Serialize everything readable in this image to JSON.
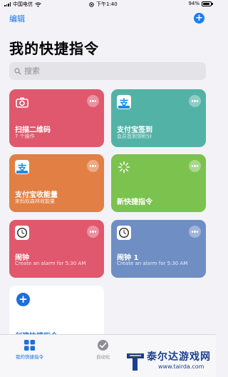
{
  "status_bar": {
    "carrier": "中国电信",
    "time": "下午1:40",
    "battery": "94%"
  },
  "header": {
    "edit_label": "编辑",
    "add_label": "+"
  },
  "page_title": "我的快捷指令",
  "search": {
    "placeholder": "搜索"
  },
  "shortcuts": [
    {
      "name": "扫描二维码",
      "subtitle": "7 个操作",
      "color": "#e0586d",
      "icon": "camera-icon"
    },
    {
      "name": "支付宝签到",
      "subtitle": "会员签到领积分",
      "color": "#53b2a6",
      "icon": "alipay-icon",
      "icon_glyph": "支"
    },
    {
      "name": "支付宝收能量",
      "subtitle": "来蚂蚁森林收能量",
      "color": "#e17f44",
      "icon": "alipay-icon",
      "icon_glyph": "支"
    },
    {
      "name": "新快捷指令",
      "subtitle": "",
      "color": "#7bc24f",
      "icon": "loading-spinner-icon"
    },
    {
      "name": "闹钟",
      "subtitle": "Create an alarm for 5:30 AM",
      "color": "#e0586d",
      "icon": "alarm-clock-icon"
    },
    {
      "name": "闹钟 1",
      "subtitle": "Create an alarm for 5:30 AM",
      "color": "#6f8ec4",
      "icon": "alarm-clock-icon"
    }
  ],
  "create_tile": {
    "label": "创建快捷指令"
  },
  "tabbar": {
    "tabs": [
      {
        "label": "我的快捷指令",
        "icon": "grid-icon",
        "active": true
      },
      {
        "label": "自动化",
        "icon": "automation-icon",
        "active": false
      }
    ]
  },
  "watermark": {
    "text": "泰尔达游戏网",
    "url": "www.tairda.com"
  }
}
